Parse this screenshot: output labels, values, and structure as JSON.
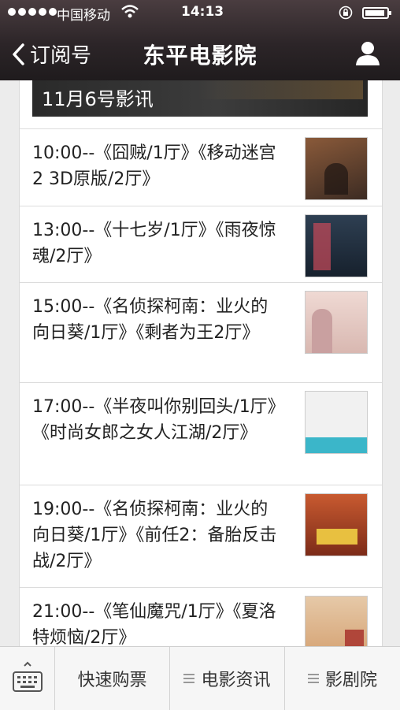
{
  "status_bar": {
    "carrier": "中国移动",
    "time": "14:13"
  },
  "nav": {
    "back_label": "订阅号",
    "title": "东平电影院"
  },
  "banner": {
    "text": "11月6号影讯"
  },
  "schedule": [
    {
      "text": "10:00--《囧贼/1厅》《移动迷宫2  3D原版/2厅》",
      "thumb_colors": [
        "#8a5a3a",
        "#3a2a22"
      ]
    },
    {
      "text": "13:00--《十七岁/1厅》《雨夜惊魂/2厅》",
      "thumb_colors": [
        "#2e3f52",
        "#c94a5a"
      ]
    },
    {
      "text": "15:00--《名侦探柯南：业火的向日葵/1厅》《剩者为王2厅》",
      "thumb_colors": [
        "#efd9d3",
        "#c9a0a0"
      ]
    },
    {
      "text": "17:00--《半夜叫你别回头/1厅》《时尚女郎之女人江湖/2厅》",
      "thumb_colors": [
        "#f1f1f1",
        "#3bb6c9"
      ]
    },
    {
      "text": "19:00--《名侦探柯南：业火的向日葵/1厅》《前任2：备胎反击战/2厅》",
      "thumb_colors": [
        "#c85a30",
        "#e8c040"
      ]
    },
    {
      "text": "21:00--《笔仙魔咒/1厅》《夏洛特烦恼/2厅》",
      "thumb_colors": [
        "#e6c9a8",
        "#b0463a"
      ]
    }
  ],
  "bottom_menu": [
    {
      "label": "快速购票"
    },
    {
      "label": "电影资讯"
    },
    {
      "label": "影剧院"
    }
  ],
  "colors": {
    "header_bg": "#2c2528",
    "bottom_bg": "#f6f6f6"
  }
}
